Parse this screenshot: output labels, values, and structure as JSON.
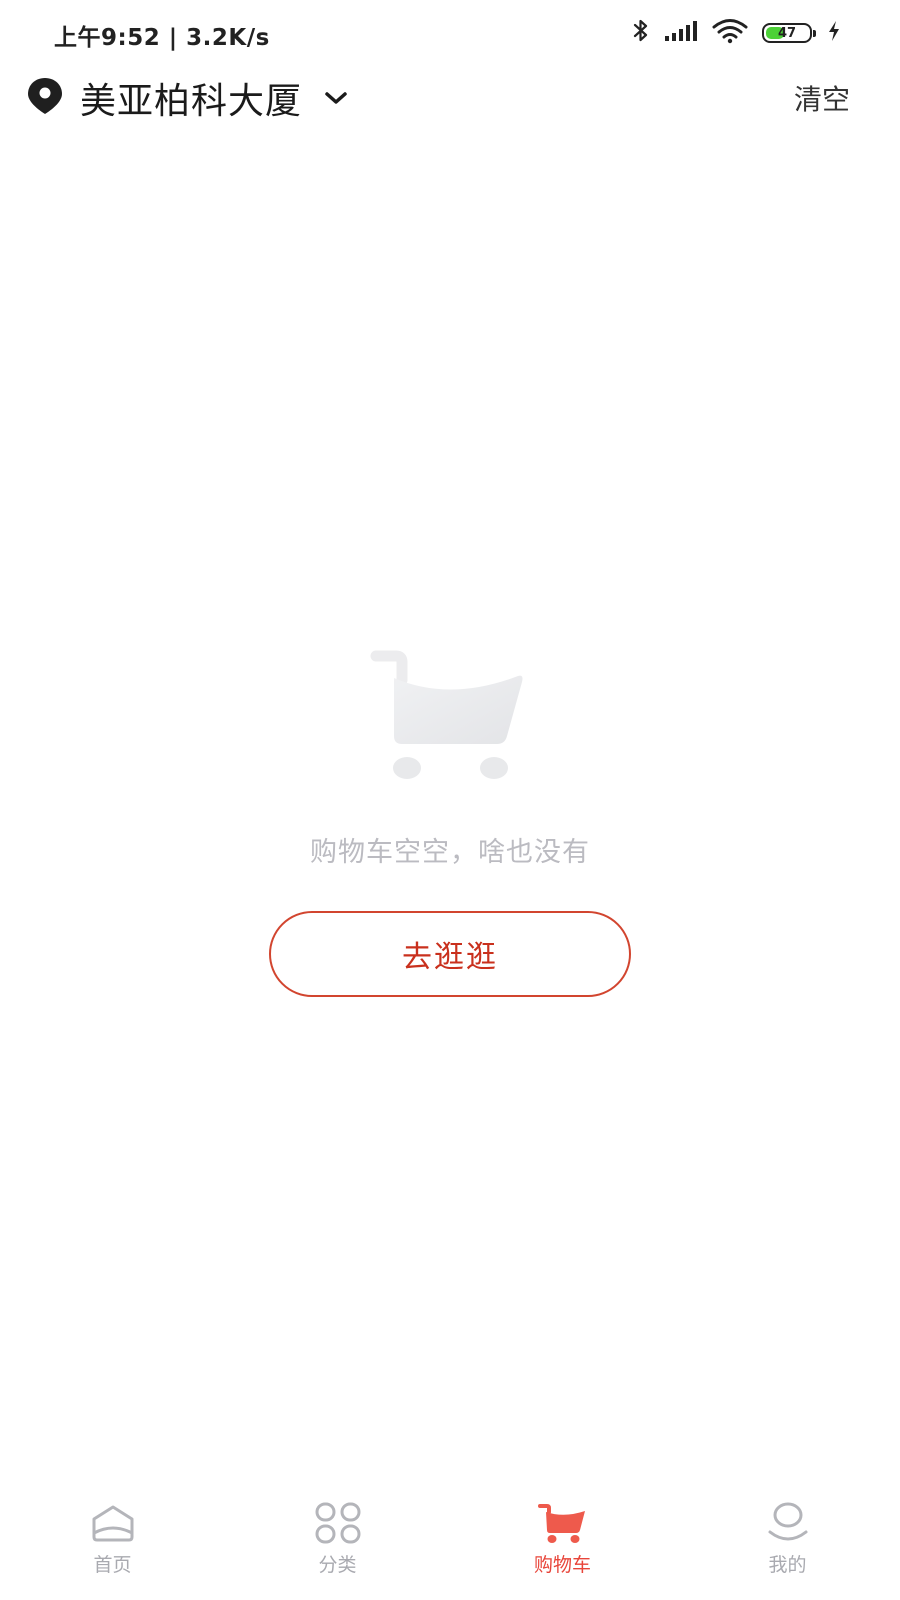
{
  "status_bar": {
    "time_speed": "上午9:52 | 3.2K/s",
    "battery_level": "47",
    "battery_percent": 47,
    "icons": [
      "bluetooth-icon",
      "cellular-signal-icon",
      "wifi-icon",
      "battery-icon",
      "charging-icon"
    ]
  },
  "header": {
    "location_name": "美亚柏科大厦",
    "clear_label": "清空",
    "icons": [
      "location-pin-icon",
      "chevron-down-icon"
    ]
  },
  "empty_state": {
    "message": "购物车空空，啥也没有",
    "button_label": "去逛逛",
    "illustration": "shopping-cart-icon"
  },
  "tabs": [
    {
      "label": "首页",
      "icon": "home-icon",
      "active": false
    },
    {
      "label": "分类",
      "icon": "category-icon",
      "active": false
    },
    {
      "label": "购物车",
      "icon": "cart-icon",
      "active": true
    },
    {
      "label": "我的",
      "icon": "user-icon",
      "active": false
    }
  ],
  "colors": {
    "accent": "#e8453a",
    "button_border": "#d2452f",
    "button_text": "#c9301d",
    "muted_text": "#bbbbc1",
    "tab_inactive": "#a9aab0",
    "battery_fill": "#4cd137"
  }
}
